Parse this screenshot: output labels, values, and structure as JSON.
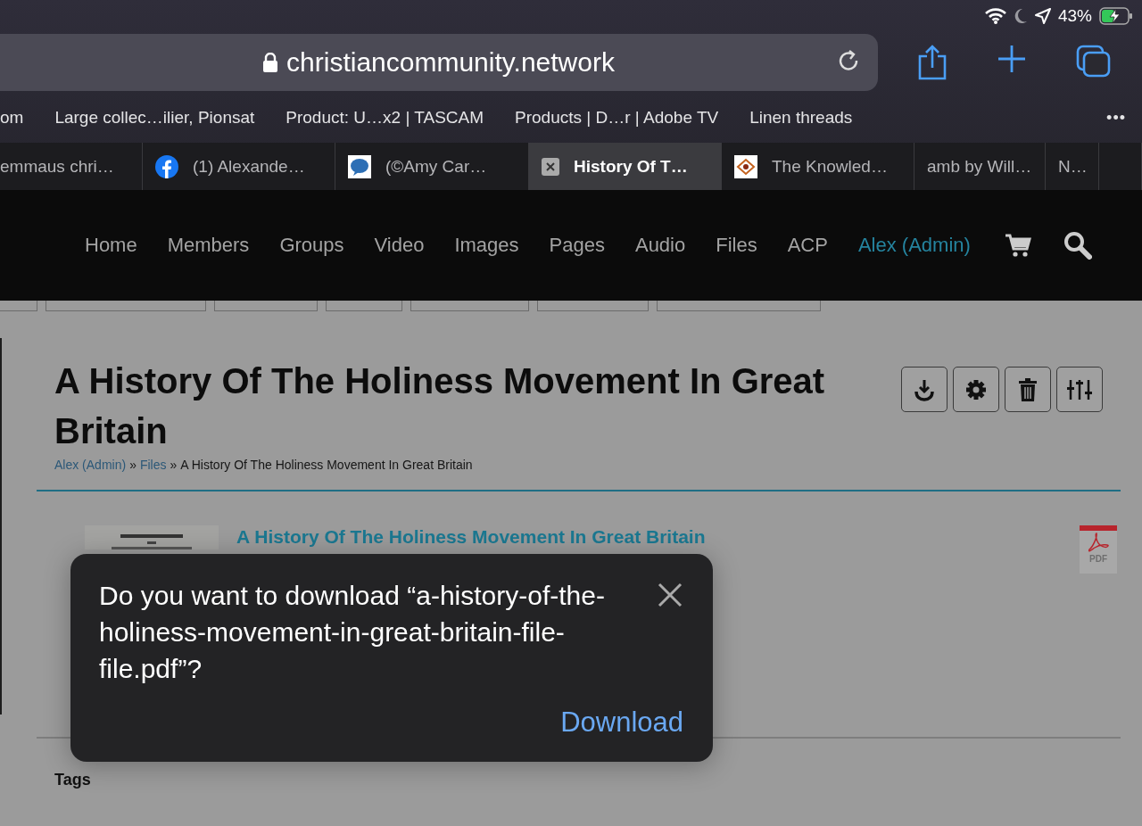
{
  "status_bar": {
    "battery": "43%"
  },
  "address_bar": {
    "url": "christiancommunity.network"
  },
  "bookmarks": [
    "om",
    "Large collec…ilier, Pionsat",
    "Product: U…x2 | TASCAM",
    "Products | D…r | Adobe TV",
    "Linen threads"
  ],
  "bookmarks_more": "•••",
  "tabs": [
    {
      "title": "emmaus chri…",
      "selected": false
    },
    {
      "title": "(1) Alexande…",
      "selected": false
    },
    {
      "title": "(©Amy Car…",
      "selected": false
    },
    {
      "title": "History Of T…",
      "selected": true
    },
    {
      "title": "The Knowled…",
      "selected": false
    },
    {
      "title": "amb by Will…",
      "selected": false
    },
    {
      "title": "N…",
      "selected": false
    }
  ],
  "site_nav": [
    {
      "label": "Home",
      "kind": "link"
    },
    {
      "label": "Members",
      "kind": "link"
    },
    {
      "label": "Groups",
      "kind": "link"
    },
    {
      "label": "Video",
      "kind": "link"
    },
    {
      "label": "Images",
      "kind": "link"
    },
    {
      "label": "Pages",
      "kind": "link"
    },
    {
      "label": "Audio",
      "kind": "link"
    },
    {
      "label": "Files",
      "kind": "link"
    },
    {
      "label": "ACP",
      "kind": "link"
    },
    {
      "label": "Alex (Admin)",
      "kind": "user"
    }
  ],
  "page": {
    "title": "A History Of The Holiness Movement In Great Britain",
    "breadcrumb": [
      {
        "label": "Alex (Admin)",
        "kind": "link"
      },
      {
        "label": "»",
        "kind": "separator"
      },
      {
        "label": "Files",
        "kind": "link"
      },
      {
        "label": "»",
        "kind": "separator"
      },
      {
        "label": "A History Of The Holiness Movement In Great Britain",
        "kind": "current"
      }
    ],
    "file": {
      "name": "A History Of The Holiness Movement In Great Britain",
      "type_label": "PDF"
    },
    "tags_heading": "Tags"
  },
  "dialog": {
    "message": "Do you want to download “a-history-of-the-holiness-movement-in-great-britain-file-file.pdf”?",
    "button": "Download"
  }
}
